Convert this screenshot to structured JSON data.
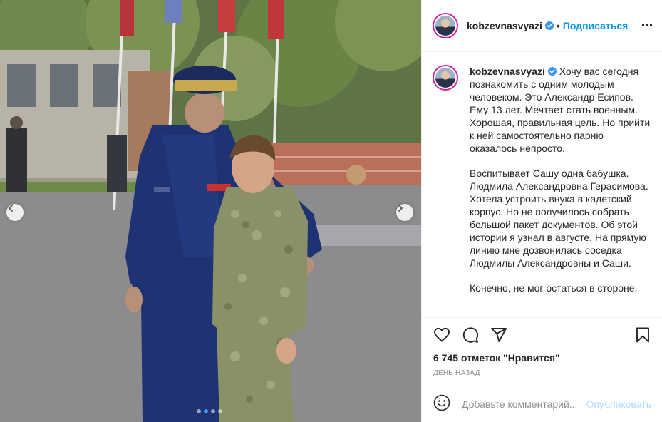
{
  "post": {
    "username": "kobzevnasvyazi",
    "verified": true,
    "follow_label": "Подписаться",
    "separator": "•",
    "caption_paragraphs": [
      "Хочу вас сегодня познакомить с одним молодым человеком. Это Александр Есипов. Ему 13 лет. Мечтает стать военным. Хорошая, правильная цель. Но прийти к ней самостоятельно парню оказалось непросто.",
      "Воспитывает Сашу одна бабушка. Людмила Александровна Герасимова. Хотела устроить внука в кадетский корпус. Но не получилось собрать большой пакет документов. Об этой истории я узнал в августе. На прямую линию мне дозвонилась соседка Людмилы Александровны и Саши.",
      "Конечно, не мог остаться в стороне."
    ],
    "likes_text": "6 745 отметок \"Нравится\"",
    "time_text": "День назад",
    "comment_placeholder": "Добавьте комментарий...",
    "publish_label": "Опубликовать"
  },
  "carousel": {
    "slide_count": 4,
    "active_index": 1
  },
  "icons": {
    "header_more": "more-horizontal-icon",
    "like": "heart-icon",
    "comment": "comment-icon",
    "share": "share-icon",
    "save": "bookmark-icon",
    "emoji": "emoji-icon",
    "prev": "chevron-left-icon",
    "next": "chevron-right-icon",
    "verified": "verified-badge-icon"
  },
  "colors": {
    "link_blue": "#0095f6",
    "publish_disabled": "#b2dffc",
    "muted_text": "#8e8e8e",
    "border": "#efefef",
    "carousel_active_dot": "#3897f0"
  }
}
